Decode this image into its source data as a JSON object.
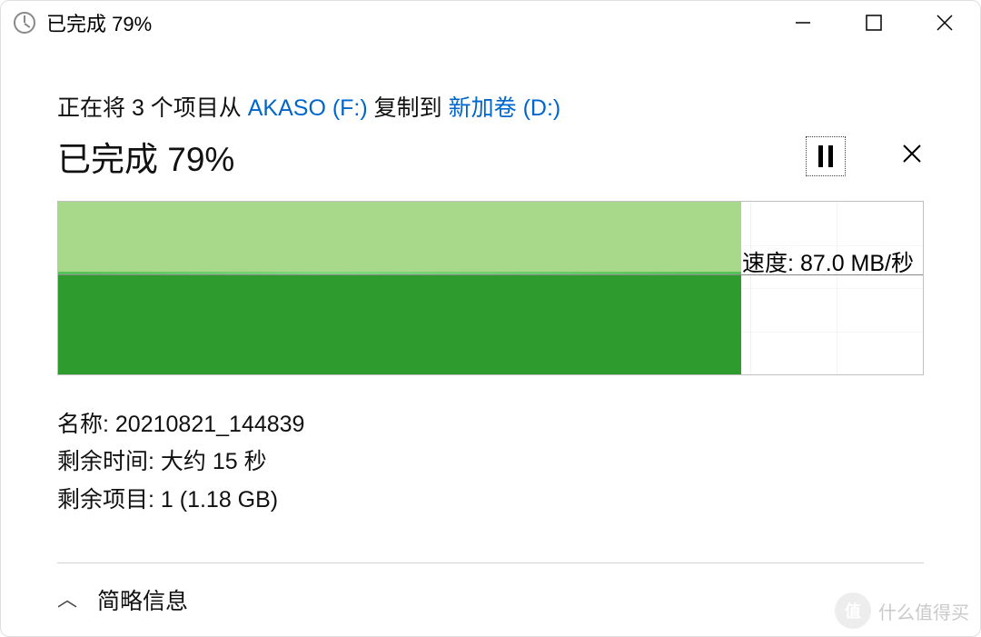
{
  "titlebar": {
    "text": "已完成 79%"
  },
  "copy": {
    "prefix": "正在将 3 个项目从 ",
    "source": "AKASO (F:)",
    "mid": " 复制到 ",
    "dest": "新加卷 (D:)"
  },
  "status": {
    "text": "已完成 79%"
  },
  "progress": {
    "percent": 79
  },
  "speed": {
    "label": "速度: ",
    "value": "87.0 MB/秒"
  },
  "details": {
    "name_label": "名称: ",
    "name_value": "20210821_144839",
    "time_label": "剩余时间: ",
    "time_value": "大约 15 秒",
    "items_label": "剩余项目: ",
    "items_value": "1 (1.18 GB)"
  },
  "footer": {
    "toggle_label": "简略信息"
  },
  "watermark": {
    "badge": "值",
    "text": "什么值得买"
  },
  "chart_data": {
    "type": "area",
    "title": "",
    "xlabel": "",
    "ylabel": "速度",
    "ylim": [
      0,
      200
    ],
    "series": [
      {
        "name": "传输速度 MB/秒",
        "values": [
          88,
          87,
          88,
          87,
          87,
          88,
          87,
          87,
          87,
          87
        ]
      }
    ],
    "progress_percent": 79,
    "current_speed_mb_s": 87.0
  }
}
